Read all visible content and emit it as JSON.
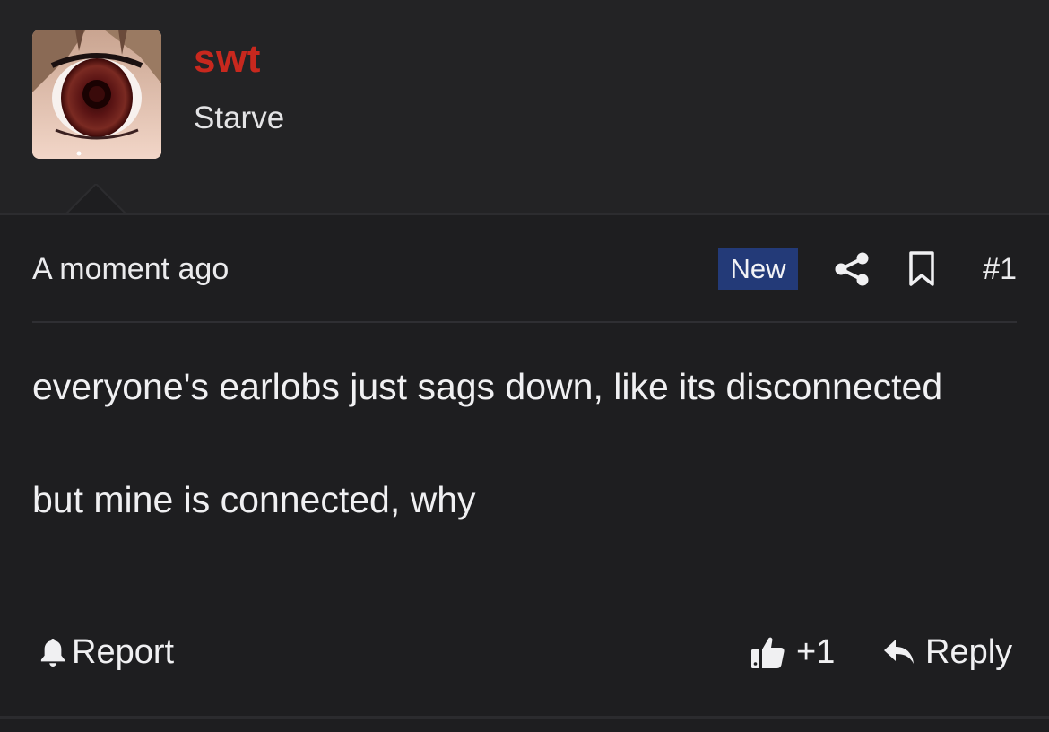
{
  "user": {
    "username": "swt",
    "title": "Starve"
  },
  "post": {
    "time": "A moment ago",
    "badge": "New",
    "number": "#1",
    "paragraphs": [
      "everyone's earlobs just sags down, like its disconnected",
      "but mine is connected, why"
    ]
  },
  "actions": {
    "report_label": "Report",
    "like_label": "+1",
    "reply_label": "Reply"
  },
  "icons": {
    "share": "share-icon",
    "bookmark": "bookmark-icon",
    "report": "bell-icon",
    "like": "thumbs-up-icon",
    "reply": "reply-icon"
  },
  "colors": {
    "username": "#c8281e",
    "badge_bg": "#233a78",
    "background": "#1e1e20"
  }
}
